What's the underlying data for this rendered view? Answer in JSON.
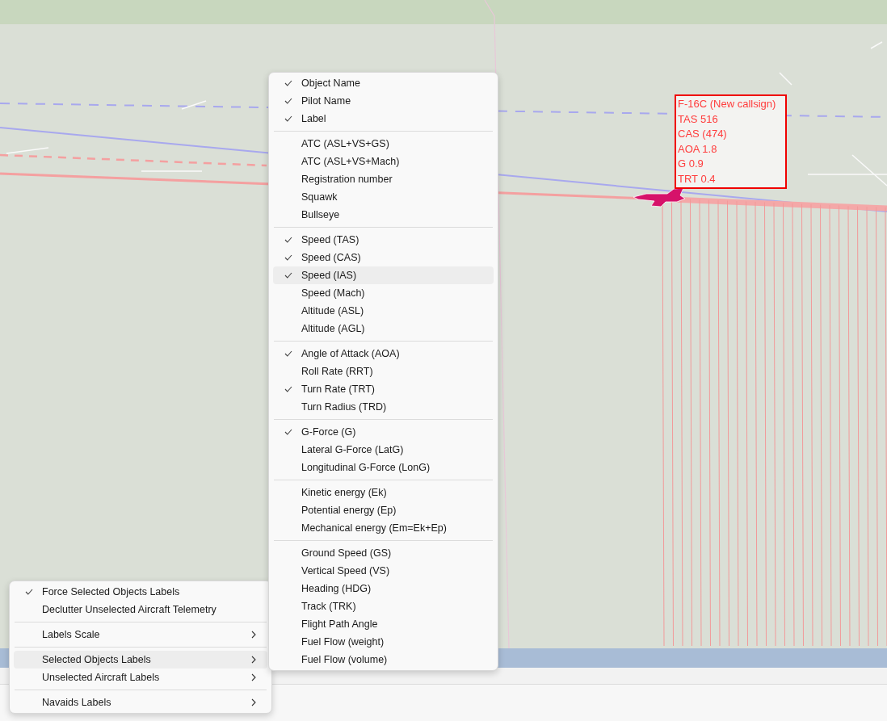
{
  "label_box": {
    "lines": [
      "F-16C (New callsign)",
      "TAS 516",
      "CAS (474)",
      "AOA 1.8",
      "G 0.9",
      "TRT 0.4"
    ]
  },
  "context_menu": {
    "groups": [
      [
        {
          "label": "Force Selected Objects Labels",
          "checked": true,
          "selected": false,
          "submenu": false
        },
        {
          "label": "Declutter Unselected Aircraft Telemetry",
          "checked": false,
          "selected": false,
          "submenu": false
        }
      ],
      [
        {
          "label": "Labels Scale",
          "checked": false,
          "selected": false,
          "submenu": true
        }
      ],
      [
        {
          "label": "Selected Objects Labels",
          "checked": false,
          "selected": true,
          "submenu": true
        },
        {
          "label": "Unselected Aircraft Labels",
          "checked": false,
          "selected": false,
          "submenu": true
        }
      ],
      [
        {
          "label": "Navaids Labels",
          "checked": false,
          "selected": false,
          "submenu": true
        }
      ]
    ]
  },
  "submenu": {
    "groups": [
      [
        {
          "label": "Object Name",
          "checked": true,
          "selected": false
        },
        {
          "label": "Pilot Name",
          "checked": true,
          "selected": false
        },
        {
          "label": "Label",
          "checked": true,
          "selected": false
        }
      ],
      [
        {
          "label": "ATC (ASL+VS+GS)",
          "checked": false,
          "selected": false
        },
        {
          "label": "ATC (ASL+VS+Mach)",
          "checked": false,
          "selected": false
        },
        {
          "label": "Registration number",
          "checked": false,
          "selected": false
        },
        {
          "label": "Squawk",
          "checked": false,
          "selected": false
        },
        {
          "label": "Bullseye",
          "checked": false,
          "selected": false
        }
      ],
      [
        {
          "label": "Speed (TAS)",
          "checked": true,
          "selected": false
        },
        {
          "label": "Speed (CAS)",
          "checked": true,
          "selected": false
        },
        {
          "label": "Speed (IAS)",
          "checked": true,
          "selected": true
        },
        {
          "label": "Speed (Mach)",
          "checked": false,
          "selected": false
        },
        {
          "label": "Altitude (ASL)",
          "checked": false,
          "selected": false
        },
        {
          "label": "Altitude (AGL)",
          "checked": false,
          "selected": false
        }
      ],
      [
        {
          "label": "Angle of Attack (AOA)",
          "checked": true,
          "selected": false
        },
        {
          "label": "Roll Rate (RRT)",
          "checked": false,
          "selected": false
        },
        {
          "label": "Turn Rate (TRT)",
          "checked": true,
          "selected": false
        },
        {
          "label": "Turn Radius (TRD)",
          "checked": false,
          "selected": false
        }
      ],
      [
        {
          "label": "G-Force (G)",
          "checked": true,
          "selected": false
        },
        {
          "label": "Lateral G-Force (LatG)",
          "checked": false,
          "selected": false
        },
        {
          "label": "Longitudinal G-Force (LonG)",
          "checked": false,
          "selected": false
        }
      ],
      [
        {
          "label": "Kinetic energy (Ek)",
          "checked": false,
          "selected": false
        },
        {
          "label": "Potential energy (Ep)",
          "checked": false,
          "selected": false
        },
        {
          "label": "Mechanical energy (Em=Ek+Ep)",
          "checked": false,
          "selected": false
        }
      ],
      [
        {
          "label": "Ground Speed (GS)",
          "checked": false,
          "selected": false
        },
        {
          "label": "Vertical Speed (VS)",
          "checked": false,
          "selected": false
        },
        {
          "label": "Heading (HDG)",
          "checked": false,
          "selected": false
        },
        {
          "label": "Track (TRK)",
          "checked": false,
          "selected": false
        },
        {
          "label": "Flight Path Angle",
          "checked": false,
          "selected": false
        },
        {
          "label": "Fuel Flow (weight)",
          "checked": false,
          "selected": false
        },
        {
          "label": "Fuel Flow (volume)",
          "checked": false,
          "selected": false
        }
      ]
    ]
  }
}
